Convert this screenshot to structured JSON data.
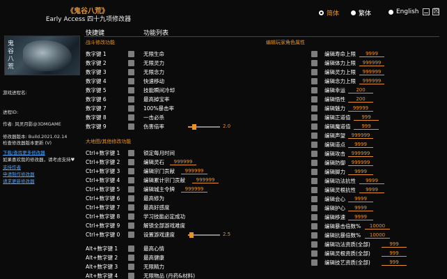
{
  "header": {
    "title": "《鬼谷八荒》",
    "subtitle": "Early Access 四十九项修改器"
  },
  "language": {
    "options": [
      {
        "label": "简体",
        "selected": true
      },
      {
        "label": "繁体",
        "selected": false
      },
      {
        "label": "English",
        "selected": false
      }
    ]
  },
  "window": {
    "min_icon": "minimize-icon",
    "close_icon": "close-icon",
    "close_glyph": "☒"
  },
  "art": {
    "logo_text": "鬼谷八荒"
  },
  "left_info": {
    "process": "游戏进程名:",
    "process_id": "进程ID:",
    "author": "作者: 风灵月影@3DMGAME",
    "version": "修改器版本: Build.2021.02.14",
    "check_update": "检查修改器版本更新 (V)",
    "download_more": "下载/查找更多修改器",
    "support_line": "如果喜欢我的修改器，请考虑支持♥",
    "support_me": "支持作者",
    "request_trainer": "申请制作修改器",
    "request_update": "请求更新修改器"
  },
  "columns": {
    "hotkeys": "快捷键",
    "functions": "功能列表"
  },
  "sections": {
    "combat": "战斗修改功能",
    "map": "大地图/其他修改功能",
    "player": "编辑玩家角色属性"
  },
  "combat_rows": [
    {
      "key": "数字键 1",
      "label": "无限生命"
    },
    {
      "key": "数字键 2",
      "label": "无限灵力"
    },
    {
      "key": "数字键 3",
      "label": "无限念力"
    },
    {
      "key": "数字键 4",
      "label": "快速移动"
    },
    {
      "key": "数字键 5",
      "label": "技能瞬间冷却"
    },
    {
      "key": "数字键 6",
      "label": "最高掉宝率"
    },
    {
      "key": "数字键 7",
      "label": "100%暴击率"
    },
    {
      "key": "数字键 8",
      "label": "一击必杀"
    },
    {
      "key": "数字键 9",
      "label": "伤害倍率",
      "slider_value": "2.0"
    }
  ],
  "map_rows": [
    {
      "key": "Ctrl+数字键 1",
      "label": "锁定每月时间"
    },
    {
      "key": "Ctrl+数字键 2",
      "label": "编辑灵石",
      "value": "999999"
    },
    {
      "key": "Ctrl+数字键 3",
      "label": "编辑宗门贡献",
      "value": "999999"
    },
    {
      "key": "Ctrl+数字键 4",
      "label": "编辑累计宗门贡献",
      "value": "999999"
    },
    {
      "key": "Ctrl+数字键 5",
      "label": "编辑城主令牌",
      "value": "999999"
    },
    {
      "key": "Ctrl+数字键 6",
      "label": "最高修为"
    },
    {
      "key": "Ctrl+数字键 7",
      "label": "最高好感度"
    },
    {
      "key": "Ctrl+数字键 8",
      "label": "学习技能必定成功"
    },
    {
      "key": "Ctrl+数字键 9",
      "label": "解锁全部游戏难度"
    },
    {
      "key": "Ctrl+数字键 0",
      "label": "设置游戏速度",
      "slider_value": "2.5"
    }
  ],
  "alt_rows": [
    {
      "key": "Alt+数字键 1",
      "label": "最高心情"
    },
    {
      "key": "Alt+数字键 2",
      "label": "最高健康"
    },
    {
      "key": "Alt+数字键 3",
      "label": "无限精力"
    },
    {
      "key": "Alt+数字键 4",
      "label": "无限物品 (丹药&材料)"
    }
  ],
  "player_rows": [
    {
      "label": "编辑寿命上限",
      "value": "9999"
    },
    {
      "label": "编辑体力上限",
      "value": "999999"
    },
    {
      "label": "编辑灵力上限",
      "value": "999999"
    },
    {
      "label": "编辑念力上限",
      "value": "999999"
    },
    {
      "label": "编辑幸运",
      "value": "200"
    },
    {
      "label": "编辑悟性",
      "value": "200"
    },
    {
      "label": "编辑魅力",
      "value": "99999"
    },
    {
      "label": "编辑正道值",
      "value": "999"
    },
    {
      "label": "编辑魔道值",
      "value": "999"
    },
    {
      "label": "编辑声望",
      "value": "999999"
    },
    {
      "label": "编辑道点",
      "value": "9999"
    },
    {
      "label": "编辑攻击",
      "value": "999999"
    },
    {
      "label": "编辑防御",
      "value": "999999"
    },
    {
      "label": "编辑脚力",
      "value": "9999"
    },
    {
      "label": "编辑功法抗性",
      "value": "9999"
    },
    {
      "label": "编辑灵根抗性",
      "value": "9999"
    },
    {
      "label": "编辑会心",
      "value": "9999"
    },
    {
      "label": "编辑护心",
      "value": "9999"
    },
    {
      "label": "编辑移速",
      "value": "9999"
    },
    {
      "label": "编辑暴击倍数%",
      "value": "10000"
    },
    {
      "label": "编辑抗暴倍数%",
      "value": "10000"
    },
    {
      "label": "编辑功法资质(全部)",
      "value": "999"
    },
    {
      "label": "编辑灵根资质(全部)",
      "value": "999"
    },
    {
      "label": "编辑技艺资质(全部)",
      "value": "999"
    }
  ],
  "sliders": {
    "damage_fraction": 0.2,
    "speed_fraction": 0.1
  },
  "colors": {
    "accent": "#e8922a",
    "background": "#0b0b0b",
    "link": "#4aa3ff",
    "toggle": "#7e7e7e"
  }
}
